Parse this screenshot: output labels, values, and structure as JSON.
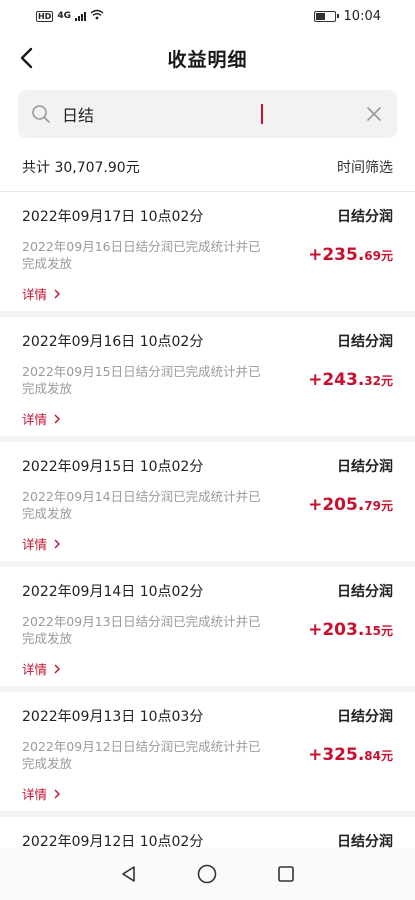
{
  "status_bar": {
    "network": "4G",
    "hd": "HD",
    "time": "10:04",
    "icons": [
      "signal-icon",
      "wifi-icon",
      "battery-icon"
    ]
  },
  "header": {
    "title": "收益明细",
    "back_icon": "chevron-left-icon"
  },
  "search": {
    "value": "日结",
    "icon": "search-icon",
    "clear_icon": "close-icon"
  },
  "summary": {
    "total": "共计 30,707.90元",
    "filter_label": "时间筛选"
  },
  "records": [
    {
      "datetime": "2022年09月17日 10点02分",
      "type": "日结分润",
      "desc": "2022年09月16日日结分润已完成统计并已完成发放",
      "amount_int": "+235.",
      "amount_dec": "69元",
      "detail": "详情"
    },
    {
      "datetime": "2022年09月16日 10点02分",
      "type": "日结分润",
      "desc": "2022年09月15日日结分润已完成统计并已完成发放",
      "amount_int": "+243.",
      "amount_dec": "32元",
      "detail": "详情"
    },
    {
      "datetime": "2022年09月15日 10点02分",
      "type": "日结分润",
      "desc": "2022年09月14日日结分润已完成统计并已完成发放",
      "amount_int": "+205.",
      "amount_dec": "79元",
      "detail": "详情"
    },
    {
      "datetime": "2022年09月14日 10点02分",
      "type": "日结分润",
      "desc": "2022年09月13日日结分润已完成统计并已完成发放",
      "amount_int": "+203.",
      "amount_dec": "15元",
      "detail": "详情"
    },
    {
      "datetime": "2022年09月13日 10点03分",
      "type": "日结分润",
      "desc": "2022年09月12日日结分润已完成统计并已完成发放",
      "amount_int": "+325.",
      "amount_dec": "84元",
      "detail": "详情"
    },
    {
      "datetime": "2022年09月12日 10点02分",
      "type": "日结分润",
      "desc": "",
      "amount_int": "",
      "amount_dec": "",
      "detail": ""
    }
  ],
  "colors": {
    "accent": "#c8102e",
    "muted_text": "#9a9a9a",
    "search_bg": "#f2f2f2"
  },
  "nav": {
    "icons": [
      "back-triangle-icon",
      "home-circle-icon",
      "recents-square-icon"
    ]
  }
}
